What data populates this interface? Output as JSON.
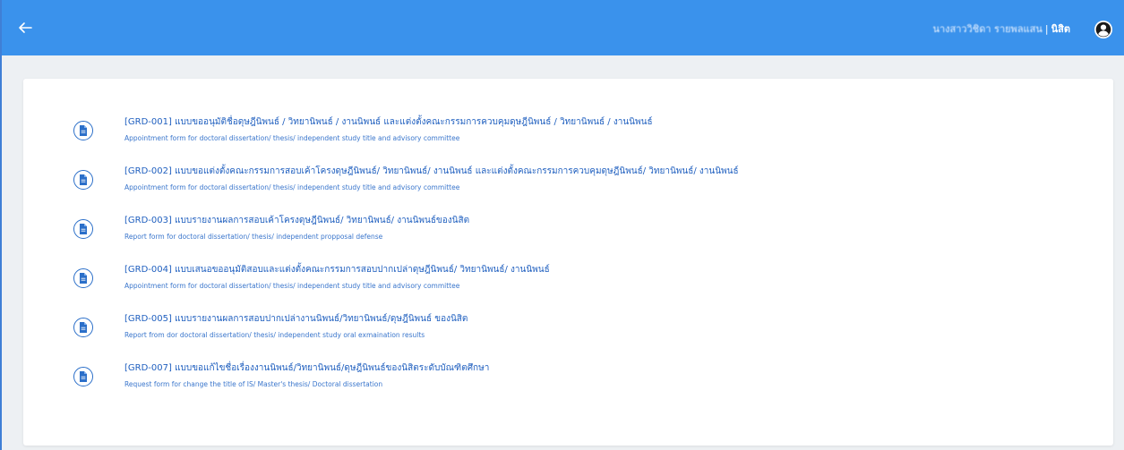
{
  "header": {
    "user_name": "นางสาววิชิดา รายพลแสน",
    "separator": "|",
    "user_role": "นิสิต",
    "back_icon": "arrow-left-icon",
    "avatar_icon": "user-circle-icon"
  },
  "colors": {
    "header_bg": "#3a92ec",
    "page_bg": "#edf0f3",
    "link": "#1f5fbf"
  },
  "forms": [
    {
      "title": "[GRD-001] แบบขออนุมัติชื่อดุษฎีนิพนธ์ / วิทยานิพนธ์ / งานนิพนธ์ และแต่งตั้งคณะกรรมการควบคุมดุษฎีนิพนธ์ / วิทยานิพนธ์ / งานนิพนธ์",
      "subtitle": "Appointment form for doctoral dissertation/ thesis/ independent study title and advisory committee"
    },
    {
      "title": "[GRD-002] แบบขอแต่งตั้งคณะกรรมการสอบเค้าโครงดุษฎีนิพนธ์/ วิทยานิพนธ์/ งานนิพนธ์ และแต่งตั้งคณะกรรมการควบคุมดุษฎีนิพนธ์/ วิทยานิพนธ์/ งานนิพนธ์",
      "subtitle": "Appointment form for doctoral dissertation/ thesis/ independent study title and advisory committee"
    },
    {
      "title": "[GRD-003] แบบรายงานผลการสอบเค้าโครงดุษฎีนิพนธ์/ วิทยานิพนธ์/ งานนิพนธ์ของนิสิต",
      "subtitle": "Report form for doctoral dissertation/ thesis/ independent propposal defense"
    },
    {
      "title": "[GRD-004] แบบเสนอขออนุมัติสอบและแต่งตั้งคณะกรรมการสอบปากเปล่าดุษฎีนิพนธ์/ วิทยานิพนธ์/ งานนิพนธ์",
      "subtitle": "Appointment form for doctoral dissertation/ thesis/ independent study title and advisory committee"
    },
    {
      "title": "[GRD-005] แบบรายงานผลการสอบปากเปล่างานนิพนธ์/วิทยานิพนธ์/ดุษฎีนิพนธ์ ของนิสิต",
      "subtitle": "Report from dor doctoral dissertation/ thesis/ independent study oral exmaination results"
    },
    {
      "title": "[GRD-007] แบบขอแก้ไขชื่อเรื่องงานนิพนธ์/วิทยานิพนธ์/ดุษฎีนิพนธ์ของนิสิตระดับบัณฑิตศึกษา",
      "subtitle": "Request form for change the title of IS/ Master's thesis/ Doctoral dissertation"
    }
  ]
}
